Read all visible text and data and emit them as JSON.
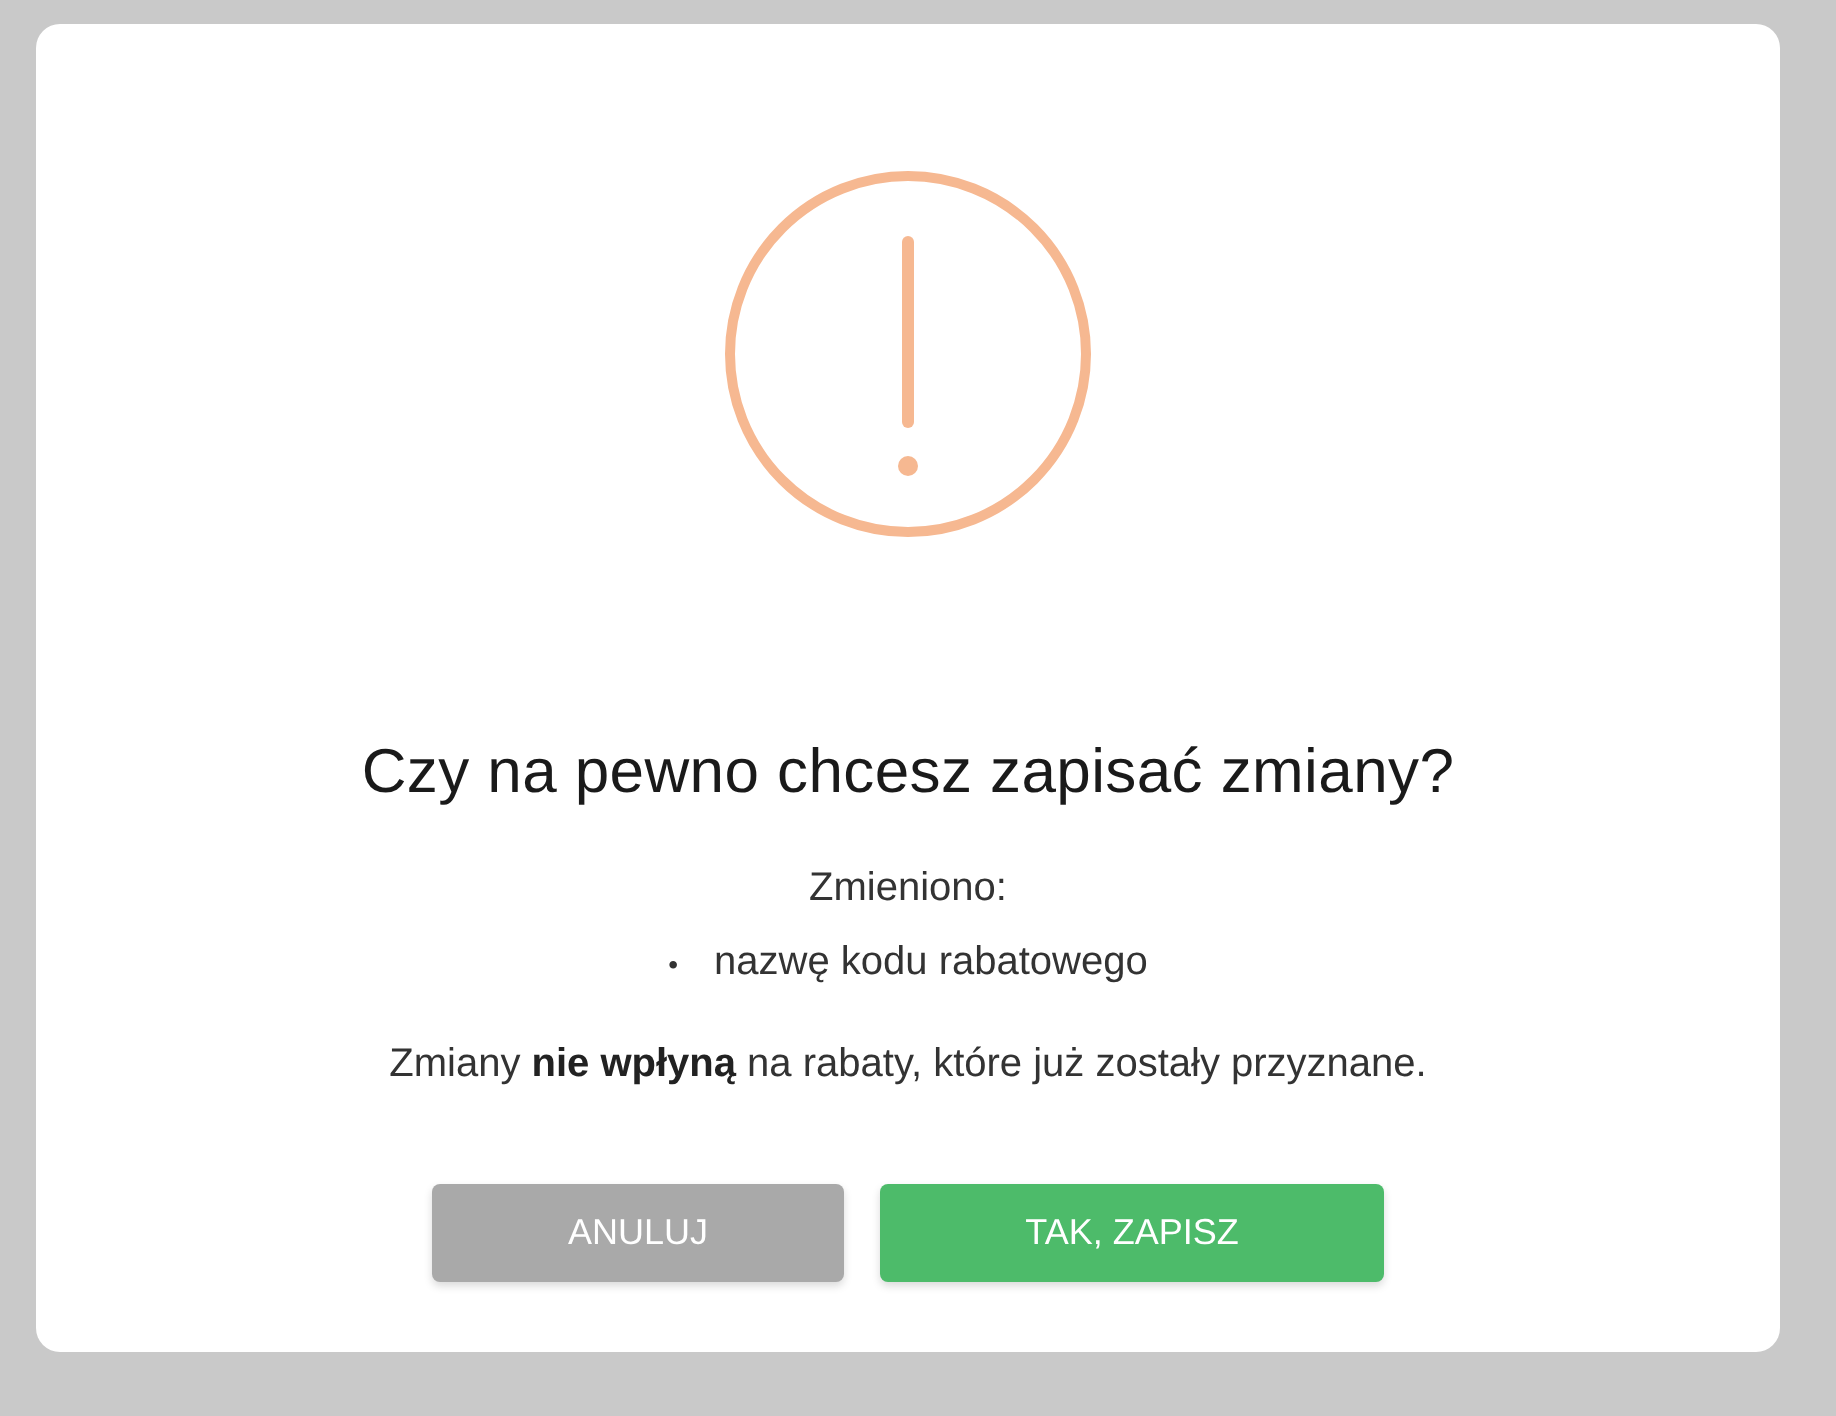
{
  "dialog": {
    "title": "Czy na pewno chcesz zapisać zmiany?",
    "changes_label": "Zmieniono:",
    "changes": [
      {
        "marker": "•",
        "text": "nazwę kodu rabatowego"
      }
    ],
    "note": "Zmiany **nie wpłyną** na rabaty, które już zostały przyznane.",
    "buttons": [
      {
        "label": "ANULUJ",
        "kind": "secondary"
      },
      {
        "label": "TAK, ZAPISZ",
        "kind": "primary"
      }
    ]
  }
}
